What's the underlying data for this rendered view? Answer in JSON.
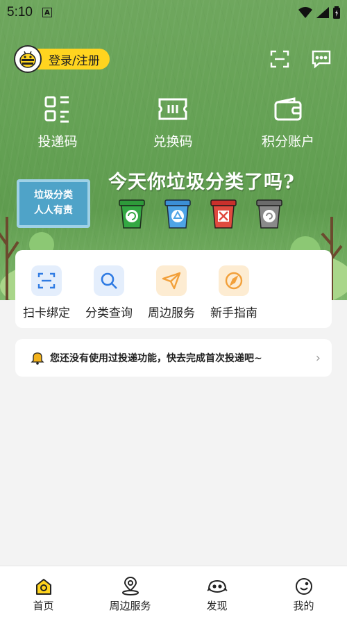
{
  "status_bar": {
    "time": "5:10",
    "notif_icon": "a-icon"
  },
  "header": {
    "login_label": "登录/注册",
    "scan_icon": "scan-icon",
    "message_icon": "message-icon"
  },
  "quick_actions": [
    {
      "label": "投递码",
      "icon": "qr-code-icon"
    },
    {
      "label": "兑换码",
      "icon": "ticket-icon"
    },
    {
      "label": "积分账户",
      "icon": "wallet-icon"
    }
  ],
  "banner": {
    "title": "今天你垃圾分类了吗?",
    "sign_line1": "垃圾分类",
    "sign_line2": "人人有责",
    "bins": [
      "green-bin",
      "blue-bin",
      "red-bin",
      "gray-bin"
    ]
  },
  "services": [
    {
      "label": "扫卡绑定",
      "icon": "scan-card-icon",
      "bg": "#e4eefc",
      "fg": "#2f7be3"
    },
    {
      "label": "分类查询",
      "icon": "search-icon",
      "bg": "#e4eefc",
      "fg": "#2f7be3"
    },
    {
      "label": "周边服务",
      "icon": "paper-plane-icon",
      "bg": "#fdecd2",
      "fg": "#f2a03a"
    },
    {
      "label": "新手指南",
      "icon": "compass-icon",
      "bg": "#fdecd2",
      "fg": "#f2a03a"
    }
  ],
  "notice": {
    "text": "您还没有使用过投递功能，快去完成首次投递吧~",
    "icon": "bell-icon"
  },
  "tabbar": [
    {
      "label": "首页",
      "icon": "home-icon",
      "active": true
    },
    {
      "label": "周边服务",
      "icon": "location-icon"
    },
    {
      "label": "发现",
      "icon": "discover-icon"
    },
    {
      "label": "我的",
      "icon": "smile-icon"
    }
  ],
  "colors": {
    "accent": "#ffd41f",
    "hero_green": "#64a154"
  }
}
